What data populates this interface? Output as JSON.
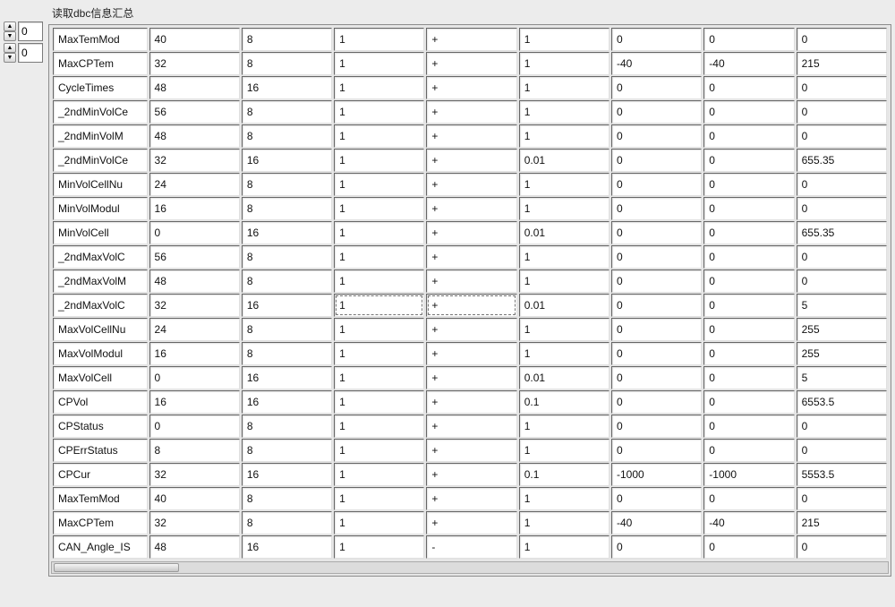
{
  "title": "读取dbc信息汇总",
  "leftControls": [
    {
      "value": "0"
    },
    {
      "value": "0"
    }
  ],
  "selectedRowIndex": 11,
  "rows": [
    {
      "name": "MaxTemMod",
      "c": [
        "40",
        "8",
        "1",
        "+",
        "1",
        "0",
        "0",
        "0"
      ]
    },
    {
      "name": "MaxCPTem",
      "c": [
        "32",
        "8",
        "1",
        "+",
        "1",
        "-40",
        "-40",
        "215"
      ]
    },
    {
      "name": "CycleTimes",
      "c": [
        "48",
        "16",
        "1",
        "+",
        "1",
        "0",
        "0",
        "0"
      ]
    },
    {
      "name": "_2ndMinVolCe",
      "c": [
        "56",
        "8",
        "1",
        "+",
        "1",
        "0",
        "0",
        "0"
      ]
    },
    {
      "name": "_2ndMinVolM",
      "c": [
        "48",
        "8",
        "1",
        "+",
        "1",
        "0",
        "0",
        "0"
      ]
    },
    {
      "name": "_2ndMinVolCe",
      "c": [
        "32",
        "16",
        "1",
        "+",
        "0.01",
        "0",
        "0",
        "655.35"
      ]
    },
    {
      "name": "MinVolCellNu",
      "c": [
        "24",
        "8",
        "1",
        "+",
        "1",
        "0",
        "0",
        "0"
      ]
    },
    {
      "name": "MinVolModul",
      "c": [
        "16",
        "8",
        "1",
        "+",
        "1",
        "0",
        "0",
        "0"
      ]
    },
    {
      "name": "MinVolCell",
      "c": [
        "0",
        "16",
        "1",
        "+",
        "0.01",
        "0",
        "0",
        "655.35"
      ]
    },
    {
      "name": "_2ndMaxVolC",
      "c": [
        "56",
        "8",
        "1",
        "+",
        "1",
        "0",
        "0",
        "0"
      ]
    },
    {
      "name": "_2ndMaxVolM",
      "c": [
        "48",
        "8",
        "1",
        "+",
        "1",
        "0",
        "0",
        "0"
      ]
    },
    {
      "name": "_2ndMaxVolC",
      "c": [
        "32",
        "16",
        "1",
        "+",
        "0.01",
        "0",
        "0",
        "5"
      ]
    },
    {
      "name": "MaxVolCellNu",
      "c": [
        "24",
        "8",
        "1",
        "+",
        "1",
        "0",
        "0",
        "255"
      ]
    },
    {
      "name": "MaxVolModul",
      "c": [
        "16",
        "8",
        "1",
        "+",
        "1",
        "0",
        "0",
        "255"
      ]
    },
    {
      "name": "MaxVolCell",
      "c": [
        "0",
        "16",
        "1",
        "+",
        "0.01",
        "0",
        "0",
        "5"
      ]
    },
    {
      "name": "CPVol",
      "c": [
        "16",
        "16",
        "1",
        "+",
        "0.1",
        "0",
        "0",
        "6553.5"
      ]
    },
    {
      "name": "CPStatus",
      "c": [
        "0",
        "8",
        "1",
        "+",
        "1",
        "0",
        "0",
        "0"
      ]
    },
    {
      "name": "CPErrStatus",
      "c": [
        "8",
        "8",
        "1",
        "+",
        "1",
        "0",
        "0",
        "0"
      ]
    },
    {
      "name": "CPCur",
      "c": [
        "32",
        "16",
        "1",
        "+",
        "0.1",
        "-1000",
        "-1000",
        "5553.5"
      ]
    },
    {
      "name": "MaxTemMod",
      "c": [
        "40",
        "8",
        "1",
        "+",
        "1",
        "0",
        "0",
        "0"
      ]
    },
    {
      "name": "MaxCPTem",
      "c": [
        "32",
        "8",
        "1",
        "+",
        "1",
        "-40",
        "-40",
        "215"
      ]
    },
    {
      "name": "CAN_Angle_IS",
      "c": [
        "48",
        "16",
        "1",
        "-",
        "1",
        "0",
        "0",
        "0"
      ]
    }
  ]
}
